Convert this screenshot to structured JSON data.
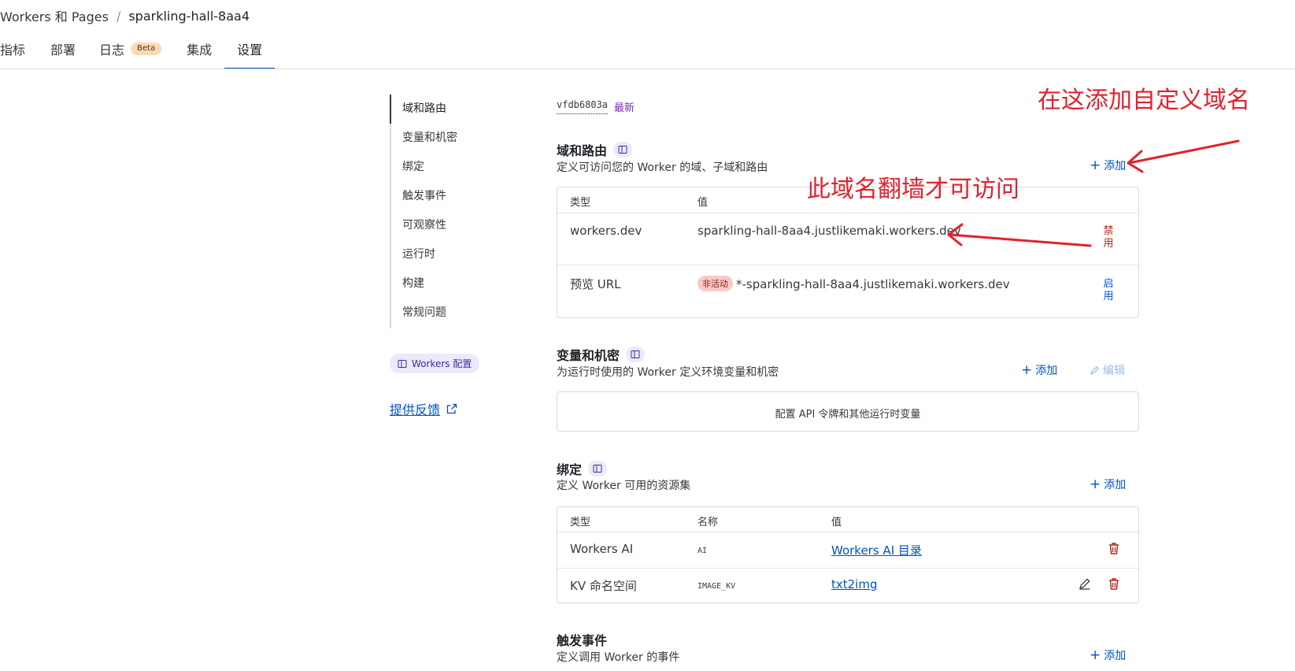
{
  "breadcrumb": {
    "root": "Workers 和 Pages",
    "current": "sparkling-hall-8aa4"
  },
  "tabs": [
    {
      "label": "指标"
    },
    {
      "label": "部署"
    },
    {
      "label": "日志",
      "badge": "Beta"
    },
    {
      "label": "集成"
    },
    {
      "label": "设置",
      "active": true
    }
  ],
  "sidenav": {
    "items": [
      "域和路由",
      "变量和机密",
      "绑定",
      "触发事件",
      "可观察性",
      "运行时",
      "构建",
      "常规问题"
    ],
    "doc_pill": "Workers 配置",
    "feedback": "提供反馈"
  },
  "version": {
    "id": "vfdb6803a",
    "tag": "最新"
  },
  "domains": {
    "title": "域和路由",
    "subtitle": "定义可访问您的 Worker 的域、子域和路由",
    "add_label": "添加",
    "headers": {
      "type": "类型",
      "value": "值"
    },
    "rows": [
      {
        "type": "workers.dev",
        "value": "sparkling-hall-8aa4.justlikemaki.workers.dev",
        "action_top": "禁",
        "action_bottom": "用"
      },
      {
        "type": "预览 URL",
        "status": "非活动",
        "value": "*-sparkling-hall-8aa4.justlikemaki.workers.dev",
        "action_top": "启",
        "action_bottom": "用"
      }
    ]
  },
  "variables": {
    "title": "变量和机密",
    "subtitle": "为运行时使用的 Worker 定义环境变量和机密",
    "add_label": "添加",
    "edit_label": "编辑",
    "message": "配置 API 令牌和其他运行时变量"
  },
  "bindings": {
    "title": "绑定",
    "subtitle": "定义 Worker 可用的资源集",
    "add_label": "添加",
    "headers": {
      "type": "类型",
      "name": "名称",
      "value": "值"
    },
    "rows": [
      {
        "type": "Workers AI",
        "name": "AI",
        "value": "Workers AI 目录"
      },
      {
        "type": "KV 命名空间",
        "name": "IMAGE_KV",
        "value": "txt2img"
      }
    ]
  },
  "triggers": {
    "title": "触发事件",
    "subtitle": "定义调用 Worker 的事件",
    "add_label": "添加"
  },
  "annotations": {
    "add_custom_domain": "在这添加自定义域名",
    "needs_vpn": "此域名翻墙才可访问"
  },
  "colors": {
    "accent": "#0051c3",
    "danger": "#b42318",
    "annotation": "#e0222e"
  }
}
